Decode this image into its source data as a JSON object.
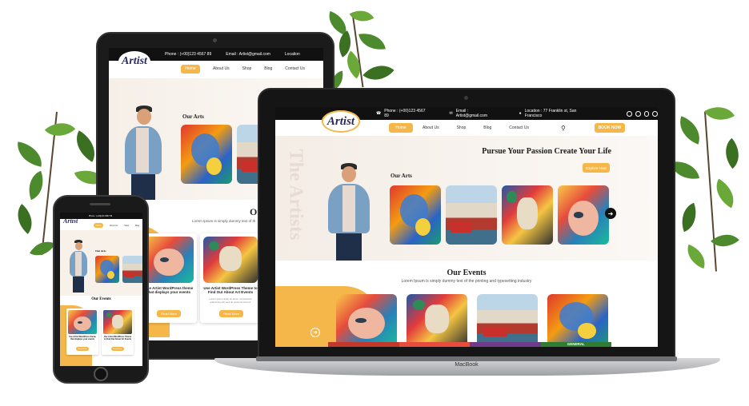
{
  "site": {
    "logo": "Artist",
    "phone": "Phone : (+00)123 4567 89",
    "email": "Email : Artist@gmail.com",
    "location": "Location : 77 Franklin st, San Francisco",
    "location_short": "Location",
    "nav": [
      "Home",
      "About Us",
      "Shop",
      "Blog",
      "Contact Us"
    ],
    "book_now": "BOOK NOW",
    "hero_title": "Pursue Your Passion Create Your Life",
    "explore": "Explore Now",
    "watermark": "The Artists",
    "our_arts": "Our Arts",
    "events_title": "Our Events",
    "events_title_partial": "Our Ev",
    "events_sub": "Lorem Ipsum is simply dummy text of the printing and typesetting industry",
    "events_sub_partial": "Lorem Ipsum is simply dummy text of th",
    "event1_title": "Use Artist WordPress theme that displays your events",
    "event2_title": "Use Artist WordPress Theme to Find Out About Art Events",
    "event_text": "Lorem ipsum dolor sit amet, consectetur adipiscing elit, sed do eiusmod tempor",
    "read_more": "Read More",
    "general": "GENERAL"
  },
  "laptop": {
    "brand": "MacBook"
  },
  "colors": {
    "accent": "#f5b74a",
    "dark": "#111111",
    "plant": "#4d8a2e"
  }
}
